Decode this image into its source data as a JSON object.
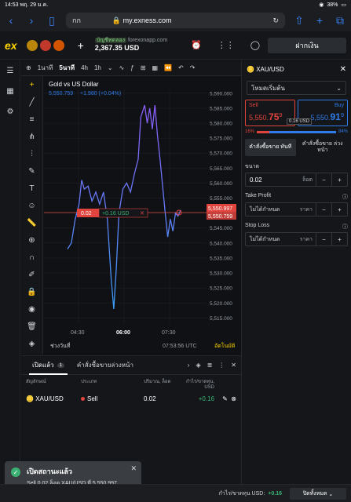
{
  "status_bar": {
    "time": "14:53",
    "date": "พฤ. 29 ม.ค.",
    "battery": "38%"
  },
  "browser": {
    "aa_label": "กก",
    "url": "my.exness.com"
  },
  "header": {
    "logo": "ex",
    "account_label": "บัญชีทดลอง",
    "account_name": "forexonapp.com",
    "balance": "2,367.35 USD",
    "deposit_label": "ฝากเงิน"
  },
  "toolbar": {
    "tf_1m": "1นาที",
    "tf_5m": "5นาที",
    "tf_4h": "4h",
    "tf_1h": "1h"
  },
  "chart": {
    "title": "Gold vs US Dollar",
    "ohlc_price": "5,550.759",
    "ohlc_change": "+1.980 (+0.04%)",
    "position_qty": "0.02",
    "position_pl": "+0.16 USD",
    "sell_label": "5,550.997",
    "bid_label": "5,550.759",
    "time_display": "07:53:56 UTC",
    "range_label": "ช่วงวันที่",
    "auto_label": "อัตโนมัติ"
  },
  "chart_data": {
    "type": "line",
    "title": "Gold vs US Dollar",
    "x": [
      "04:30",
      "06:00",
      "07:30"
    ],
    "y_ticks": [
      "5,590.000",
      "5,585.000",
      "5,580.000",
      "5,575.000",
      "5,570.000",
      "5,565.000",
      "5,560.000",
      "5,555.000",
      "5,550.000",
      "5,545.000",
      "5,540.000",
      "5,535.000",
      "5,530.000",
      "5,525.000",
      "5,520.000",
      "5,515.000"
    ],
    "ylim": [
      5513,
      5591
    ],
    "points": [
      [
        0,
        5538
      ],
      [
        3,
        5540
      ],
      [
        6,
        5548
      ],
      [
        9,
        5553
      ],
      [
        11,
        5561
      ],
      [
        13,
        5558
      ],
      [
        16,
        5559
      ],
      [
        19,
        5554
      ],
      [
        22,
        5557
      ],
      [
        25,
        5553
      ],
      [
        28,
        5557
      ],
      [
        31,
        5548
      ],
      [
        34,
        5528
      ],
      [
        36,
        5518
      ],
      [
        38,
        5532
      ],
      [
        40,
        5550
      ],
      [
        43,
        5558
      ],
      [
        46,
        5560
      ],
      [
        49,
        5557
      ],
      [
        52,
        5563
      ],
      [
        55,
        5568
      ],
      [
        57,
        5582
      ],
      [
        60,
        5586
      ],
      [
        62,
        5580
      ],
      [
        64,
        5585
      ],
      [
        66,
        5578
      ],
      [
        68,
        5586
      ],
      [
        70,
        5576
      ],
      [
        72,
        5568
      ],
      [
        74,
        5559
      ],
      [
        76,
        5550
      ],
      [
        78,
        5542
      ],
      [
        80,
        5548
      ],
      [
        82,
        5544
      ],
      [
        84,
        5550
      ],
      [
        86,
        5549
      ],
      [
        88,
        5551
      ]
    ]
  },
  "right_panel": {
    "symbol": "XAU/USD",
    "mode": "โหมดเริ่มต้น",
    "sell_label": "Sell",
    "sell_price_main": "5,550.",
    "sell_price_big": "75",
    "sell_price_sup": "9",
    "buy_label": "Buy",
    "buy_price_main": "5,550.",
    "buy_price_big": "91",
    "buy_price_sup": "9",
    "spread": "0.16 USD",
    "sell_pct": "16%",
    "buy_pct": "84%",
    "sell_ratio": 0.16,
    "order_market": "คำสั่งซื้อขาย ทันที",
    "order_pending": "คำสั่งซื้อขาย ล่วงหน้า",
    "volume_label": "ขนาด",
    "volume_value": "0.02",
    "volume_unit": "ล็อต",
    "tp_label": "Take Profit",
    "tp_value": "ไม่ได้กำหนด",
    "tp_unit": "ราคา",
    "sl_label": "Stop Loss",
    "sl_value": "ไม่ได้กำหนด",
    "sl_unit": "ราคา"
  },
  "bottom_panel": {
    "tab_open": "เปิดแล้ว",
    "open_count": "1",
    "tab_pending": "คำสั่งซื้อขายล่วงหน้า",
    "col_symbol": "สัญลักษณ์",
    "col_type": "ประเภท",
    "col_volume": "ปริมาณ, ล็อต",
    "col_pl": "กำไร/ขาดทุน, USD",
    "row": {
      "symbol": "XAU/USD",
      "type": "Sell",
      "volume": "0.02",
      "pl": "+0.16"
    }
  },
  "toast": {
    "title": "เปิดสถานะแล้ว",
    "message": "Sell 0.02 ล็อต XAU/USD ที่ 5,550.997"
  },
  "footer": {
    "label": "กำไร/ขาดทุน USD:",
    "pl": "+0.16",
    "close_all": "ปิดทั้งหมด"
  }
}
